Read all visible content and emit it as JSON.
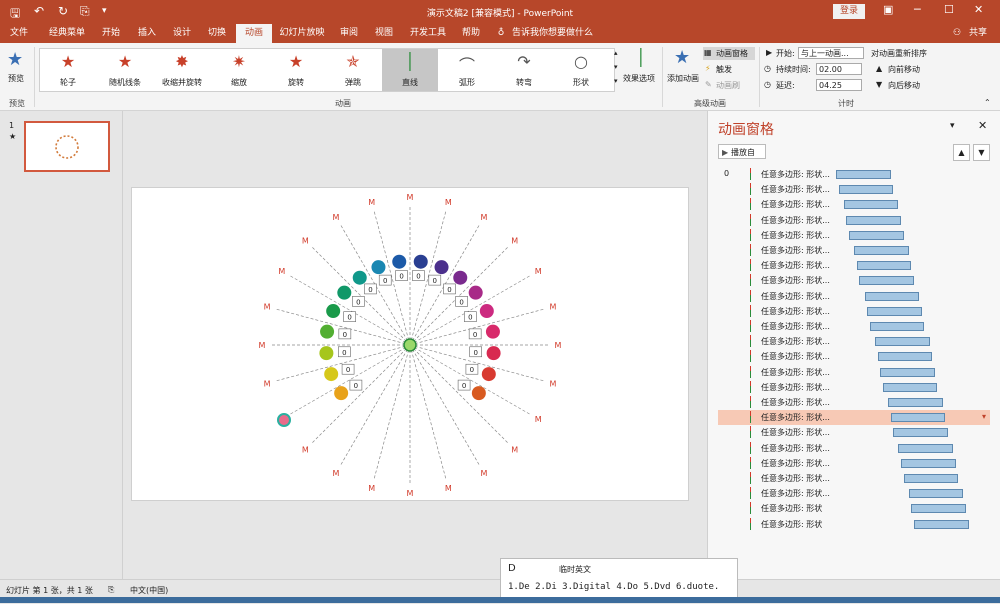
{
  "app": {
    "title": "演示文稿2 [兼容模式] - PowerPoint",
    "login": "登录",
    "share": "共享",
    "tell_me": "告诉我你想要做什么"
  },
  "tabs": [
    "文件",
    "经典菜单",
    "开始",
    "插入",
    "设计",
    "切换",
    "动画",
    "幻灯片放映",
    "审阅",
    "视图",
    "开发工具",
    "帮助"
  ],
  "active_tab": "动画",
  "ribbon": {
    "preview": "预览",
    "preview_group": "预览",
    "animations": [
      "轮子",
      "随机线条",
      "收缩并旋转",
      "缩放",
      "旋转",
      "弹跳",
      "直线",
      "弧形",
      "转弯",
      "形状"
    ],
    "selected_animation": "直线",
    "animation_group": "动画",
    "effect_options": "效果选项",
    "add_animation": "添加动画",
    "anim_pane": "动画窗格",
    "trigger": "触发",
    "anim_painter": "动画刷",
    "advanced_group": "高级动画",
    "start_label": "开始:",
    "start_value": "与上一动画...",
    "duration_label": "持续时间:",
    "duration_value": "02.00",
    "delay_label": "延迟:",
    "delay_value": "04.25",
    "timing_group": "计时",
    "reorder_title": "对动画重新排序",
    "move_earlier": "向前移动",
    "move_later": "向后移动"
  },
  "thumbnails": {
    "number": "1",
    "star": "★"
  },
  "slide": {
    "label_value": "0",
    "spoke_glyph": "M"
  },
  "pane": {
    "title": "动画窗格",
    "play": "播放自",
    "first_index": "0",
    "item_label": "任意多边形: 形状...",
    "item_label_short": "任意多边形: 形状",
    "items": [
      {
        "start": 0.0,
        "len": 0.21
      },
      {
        "start": 0.01,
        "len": 0.21
      },
      {
        "start": 0.03,
        "len": 0.21
      },
      {
        "start": 0.04,
        "len": 0.21
      },
      {
        "start": 0.05,
        "len": 0.21
      },
      {
        "start": 0.07,
        "len": 0.21
      },
      {
        "start": 0.08,
        "len": 0.21
      },
      {
        "start": 0.09,
        "len": 0.21
      },
      {
        "start": 0.11,
        "len": 0.21
      },
      {
        "start": 0.12,
        "len": 0.21
      },
      {
        "start": 0.13,
        "len": 0.21
      },
      {
        "start": 0.15,
        "len": 0.21
      },
      {
        "start": 0.16,
        "len": 0.21
      },
      {
        "start": 0.17,
        "len": 0.21
      },
      {
        "start": 0.18,
        "len": 0.21
      },
      {
        "start": 0.2,
        "len": 0.21
      },
      {
        "start": 0.21,
        "len": 0.21
      },
      {
        "start": 0.22,
        "len": 0.21
      },
      {
        "start": 0.24,
        "len": 0.21
      },
      {
        "start": 0.25,
        "len": 0.21
      },
      {
        "start": 0.26,
        "len": 0.21
      },
      {
        "start": 0.28,
        "len": 0.21
      },
      {
        "start": 0.29,
        "len": 0.21
      },
      {
        "start": 0.3,
        "len": 0.21
      }
    ],
    "selected_index": 16
  },
  "status": {
    "slide_info": "幻灯片 第 1 张，共 1 张",
    "language": "中文(中国)"
  },
  "ime": {
    "input": "D",
    "mode": "临时英文",
    "candidates": "1.De  2.Di  3.Digital  4.Do  5.Dvd  6.duote."
  },
  "colors": {
    "accent": "#b7472a",
    "pane_title": "#c0422a",
    "bar_fill": "#a4c6e2",
    "selected_row": "#f7c9b5"
  }
}
